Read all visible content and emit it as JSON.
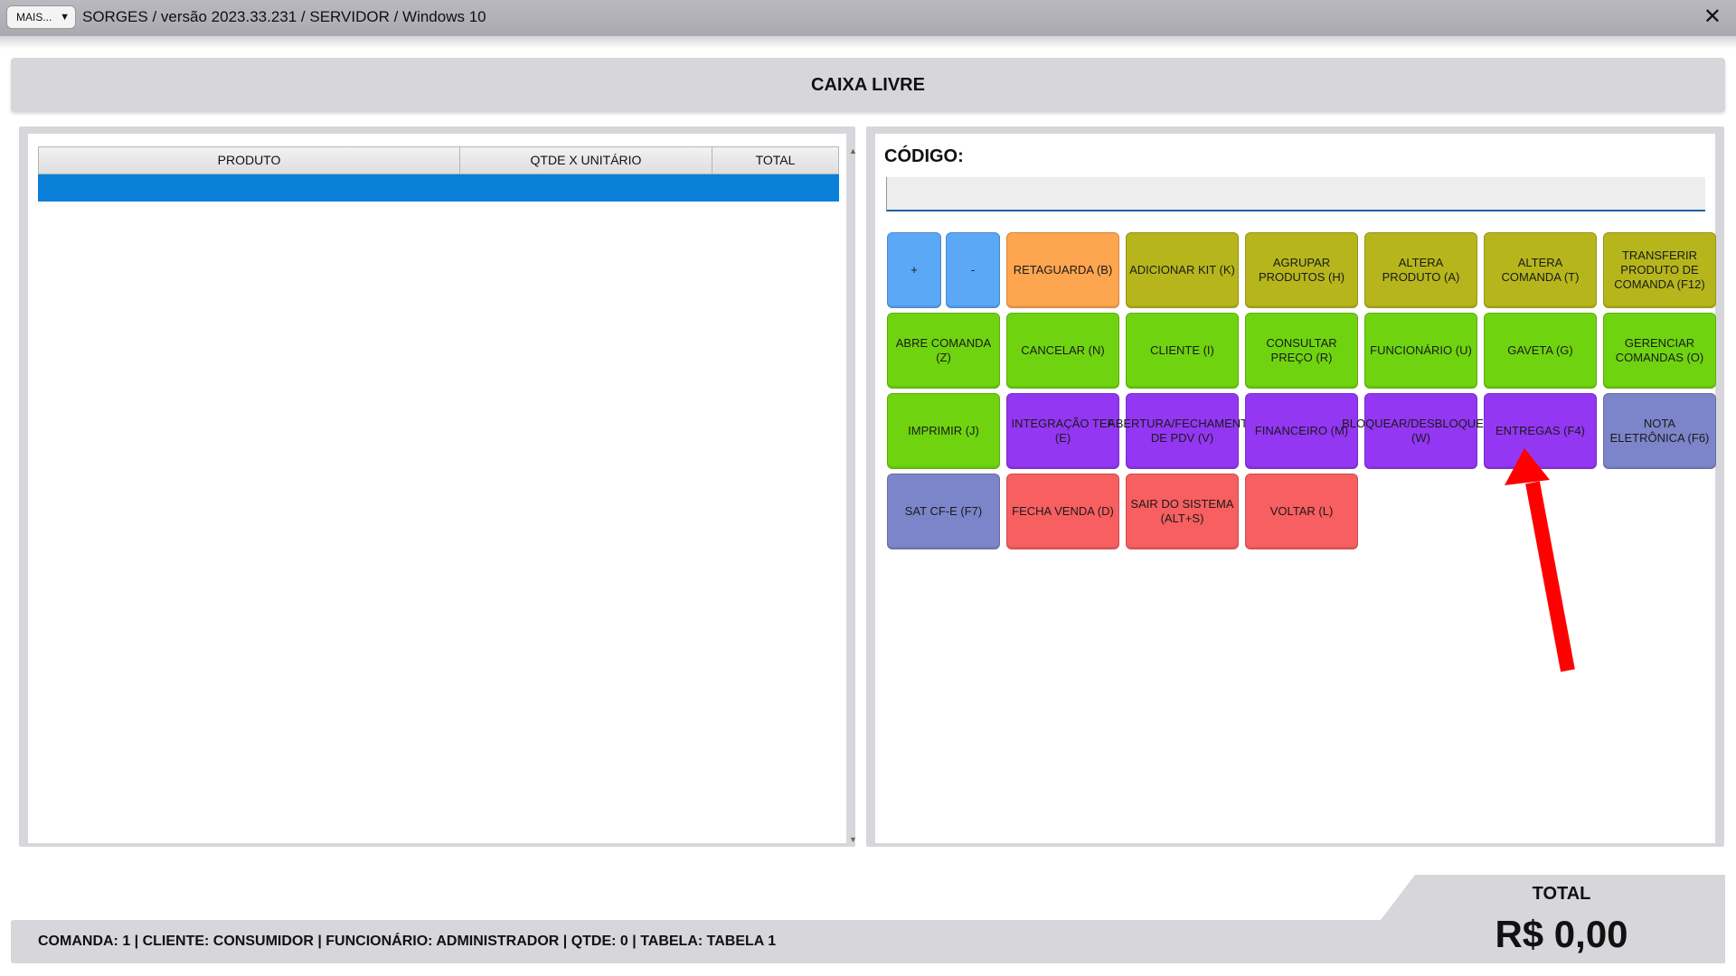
{
  "titlebar": {
    "menu_label": "MAIS...",
    "menu_arrow": "▼",
    "title": "SORGES / versão 2023.33.231 / SERVIDOR / Windows 10",
    "close_glyph": "✕"
  },
  "banner": {
    "text": "CAIXA LIVRE"
  },
  "items_table": {
    "columns": [
      "PRODUTO",
      "QTDE X UNITÁRIO",
      "TOTAL"
    ],
    "rows": []
  },
  "code": {
    "label": "CÓDIGO:",
    "value": ""
  },
  "buttons": [
    {
      "label": "+",
      "color": "#5aa8f6"
    },
    {
      "label": "-",
      "color": "#5aa8f6"
    },
    {
      "label": "RETAGUARDA (B)",
      "color": "#fea54f"
    },
    {
      "label": "ADICIONAR KIT (K)",
      "color": "#b6b61c"
    },
    {
      "label": "AGRUPAR PRODUTOS (H)",
      "color": "#b6b61c"
    },
    {
      "label": "ALTERA PRODUTO (A)",
      "color": "#b6b61c"
    },
    {
      "label": "ALTERA COMANDA (T)",
      "color": "#b6b61c"
    },
    {
      "label": "TRANSFERIR PRODUTO DE COMANDA (F12)",
      "color": "#b6b61c"
    },
    {
      "label": "ABRE COMANDA (Z)",
      "color": "#6fd40f"
    },
    {
      "label": "CANCELAR (N)",
      "color": "#6fd40f"
    },
    {
      "label": "CLIENTE (I)",
      "color": "#6fd40f"
    },
    {
      "label": "CONSULTAR PREÇO (R)",
      "color": "#6fd40f"
    },
    {
      "label": "FUNCIONÁRIO (U)",
      "color": "#6fd40f"
    },
    {
      "label": "GAVETA (G)",
      "color": "#6fd40f"
    },
    {
      "label": "GERENCIAR COMANDAS (O)",
      "color": "#6fd40f"
    },
    {
      "label": "IMPRIMIR (J)",
      "color": "#6fd40f"
    },
    {
      "label": "INTEGRAÇÃO TEF (E)",
      "color": "#9337f3"
    },
    {
      "label": "ABERTURA/FECHAMENTO DE PDV (V)",
      "color": "#9337f3"
    },
    {
      "label": "FINANCEIRO (M)",
      "color": "#9337f3"
    },
    {
      "label": "BLOQUEAR/DESBLOQUEAR (W)",
      "color": "#9337f3"
    },
    {
      "label": "ENTREGAS (F4)",
      "color": "#9337f3"
    },
    {
      "label": "NOTA ELETRÔNICA (F6)",
      "color": "#7c85c9"
    },
    {
      "label": "SAT CF-E (F7)",
      "color": "#7c85c9"
    },
    {
      "label": "FECHA VENDA (D)",
      "color": "#f85f61"
    },
    {
      "label": "SAIR DO SISTEMA (ALT+S)",
      "color": "#f85f61"
    },
    {
      "label": "VOLTAR (L)",
      "color": "#f85f61"
    }
  ],
  "status": {
    "text": "COMANDA: 1  |  CLIENTE: CONSUMIDOR  |  FUNCIONÁRIO: ADMINISTRADOR  |  QTDE: 0  |  TABELA: TABELA 1"
  },
  "total": {
    "label": "TOTAL",
    "value": "R$ 0,00"
  },
  "annotation": {
    "color": "#ff0000"
  }
}
